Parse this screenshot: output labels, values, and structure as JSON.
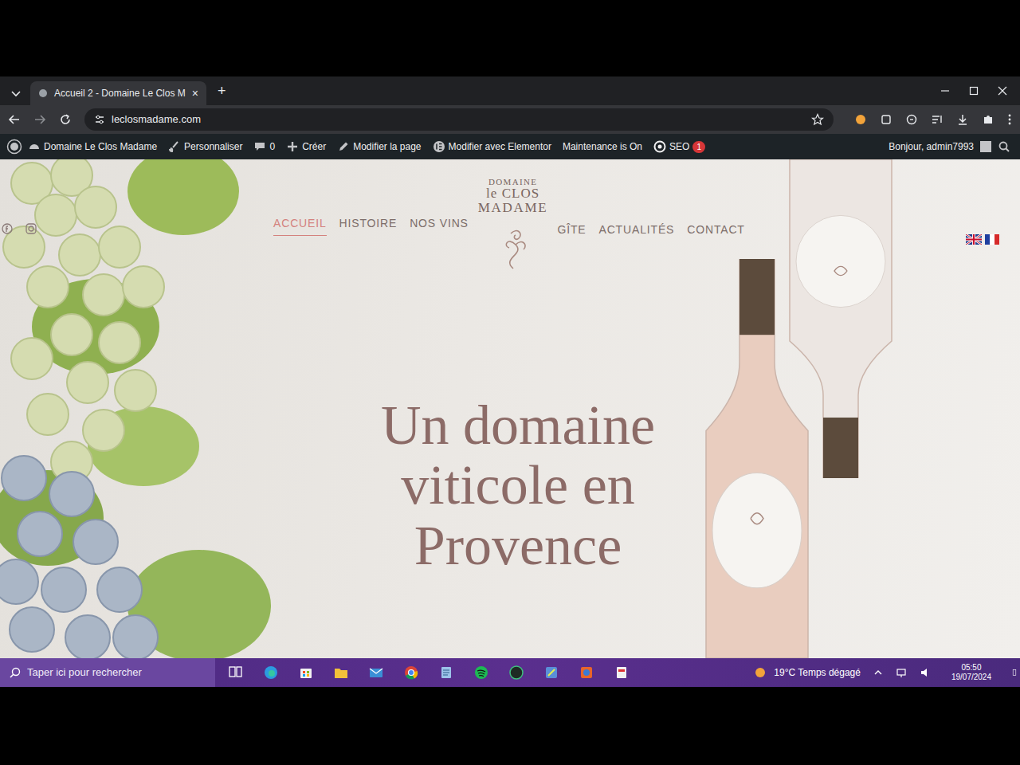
{
  "browser": {
    "tabs": [
      {
        "label": "Accueil 2 - Domaine Le Clos M",
        "close": "×",
        "selected": true
      }
    ],
    "new_tab": "+",
    "address": "leclosmadame.com"
  },
  "admin_bar": {
    "items": [
      {
        "kind": "site",
        "label": "Domaine Le Clos Madame"
      },
      {
        "kind": "customize",
        "label": "Personnaliser"
      },
      {
        "kind": "comments",
        "label": "0"
      },
      {
        "kind": "create",
        "label": "Créer"
      },
      {
        "kind": "edit",
        "label": "Modifier la page"
      },
      {
        "kind": "elementor",
        "label": "Modifier avec Elementor"
      },
      {
        "kind": "plain",
        "label": "Maintenance is On"
      },
      {
        "kind": "seo",
        "label": "SEO",
        "badge": "1"
      }
    ],
    "greeting": "Bonjour, admin7993"
  },
  "site": {
    "logo": {
      "line1": "DOMAINE",
      "line2": "le CLOS",
      "line3": "MADAME"
    },
    "nav_left": [
      {
        "label": "ACCUEIL",
        "selected": true
      },
      {
        "label": "HISTOIRE",
        "selected": false
      },
      {
        "label": "NOS VINS",
        "selected": false
      }
    ],
    "nav_right": [
      {
        "label": "GÎTE",
        "selected": false
      },
      {
        "label": "ACTUALITÉS",
        "selected": false
      },
      {
        "label": "CONTACT",
        "selected": false
      }
    ],
    "hero_title": [
      "Un domaine",
      "viticole en",
      "Provence"
    ]
  },
  "taskbar": {
    "search": "Taper ici pour rechercher",
    "weather": "19°C Temps dégagé",
    "time": "05:50",
    "date": "19/07/2024"
  }
}
